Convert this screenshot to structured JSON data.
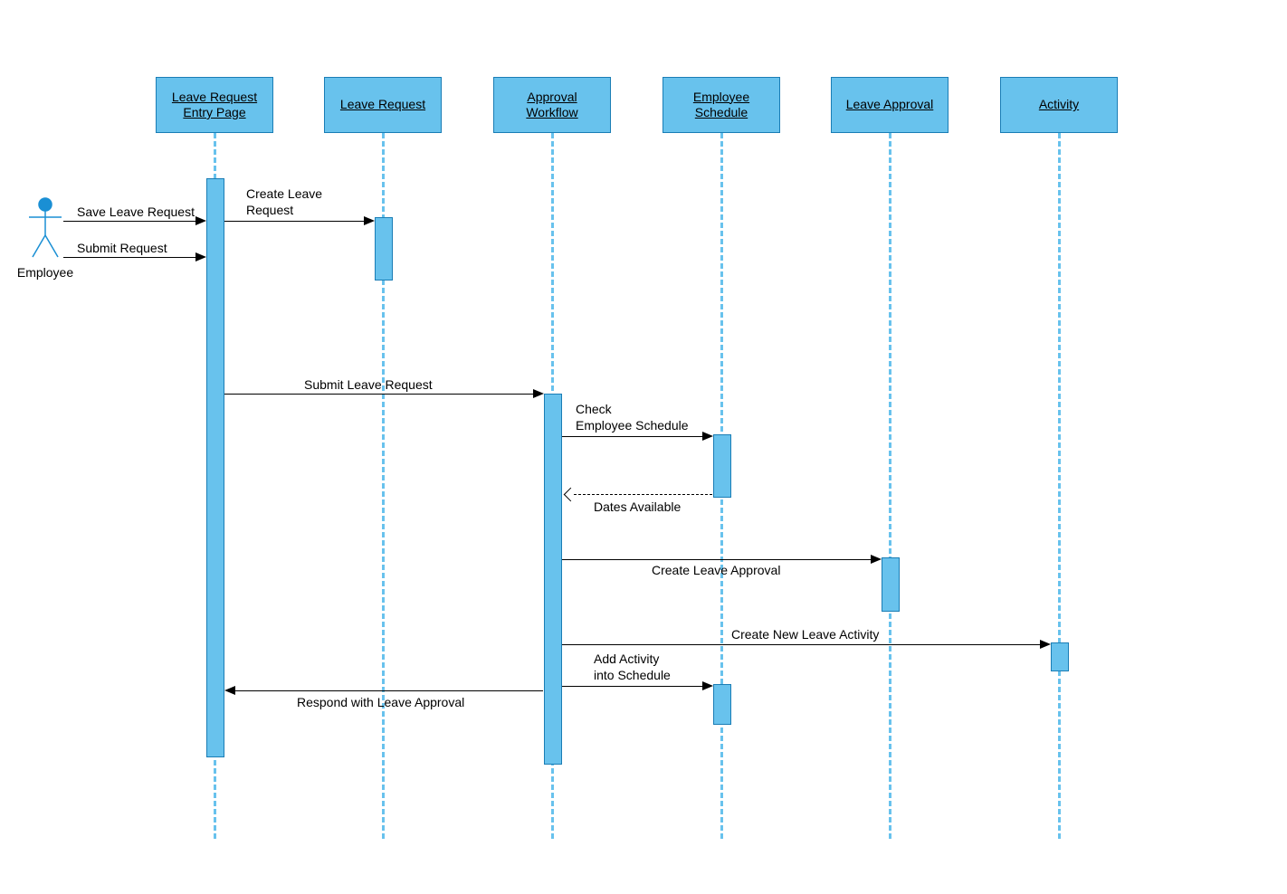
{
  "actor": {
    "label": "Employee"
  },
  "participants": {
    "p1": "Leave Request\nEntry Page",
    "p2": "Leave Request",
    "p3": "Approval\nWorkflow",
    "p4": "Employee\nSchedule",
    "p5": "Leave Approval",
    "p6": "Activity"
  },
  "messages": {
    "m1": "Save Leave Request",
    "m2": "Submit  Request",
    "m3": "Create Leave\nRequest",
    "m4": "Submit  Leave Request",
    "m5": "Check\nEmployee Schedule",
    "m6": "Dates Available",
    "m7": "Create Leave Approval",
    "m8": "Create New Leave Activity",
    "m9": "Add Activity\ninto Schedule",
    "m10": "Respond with Leave Approval"
  }
}
